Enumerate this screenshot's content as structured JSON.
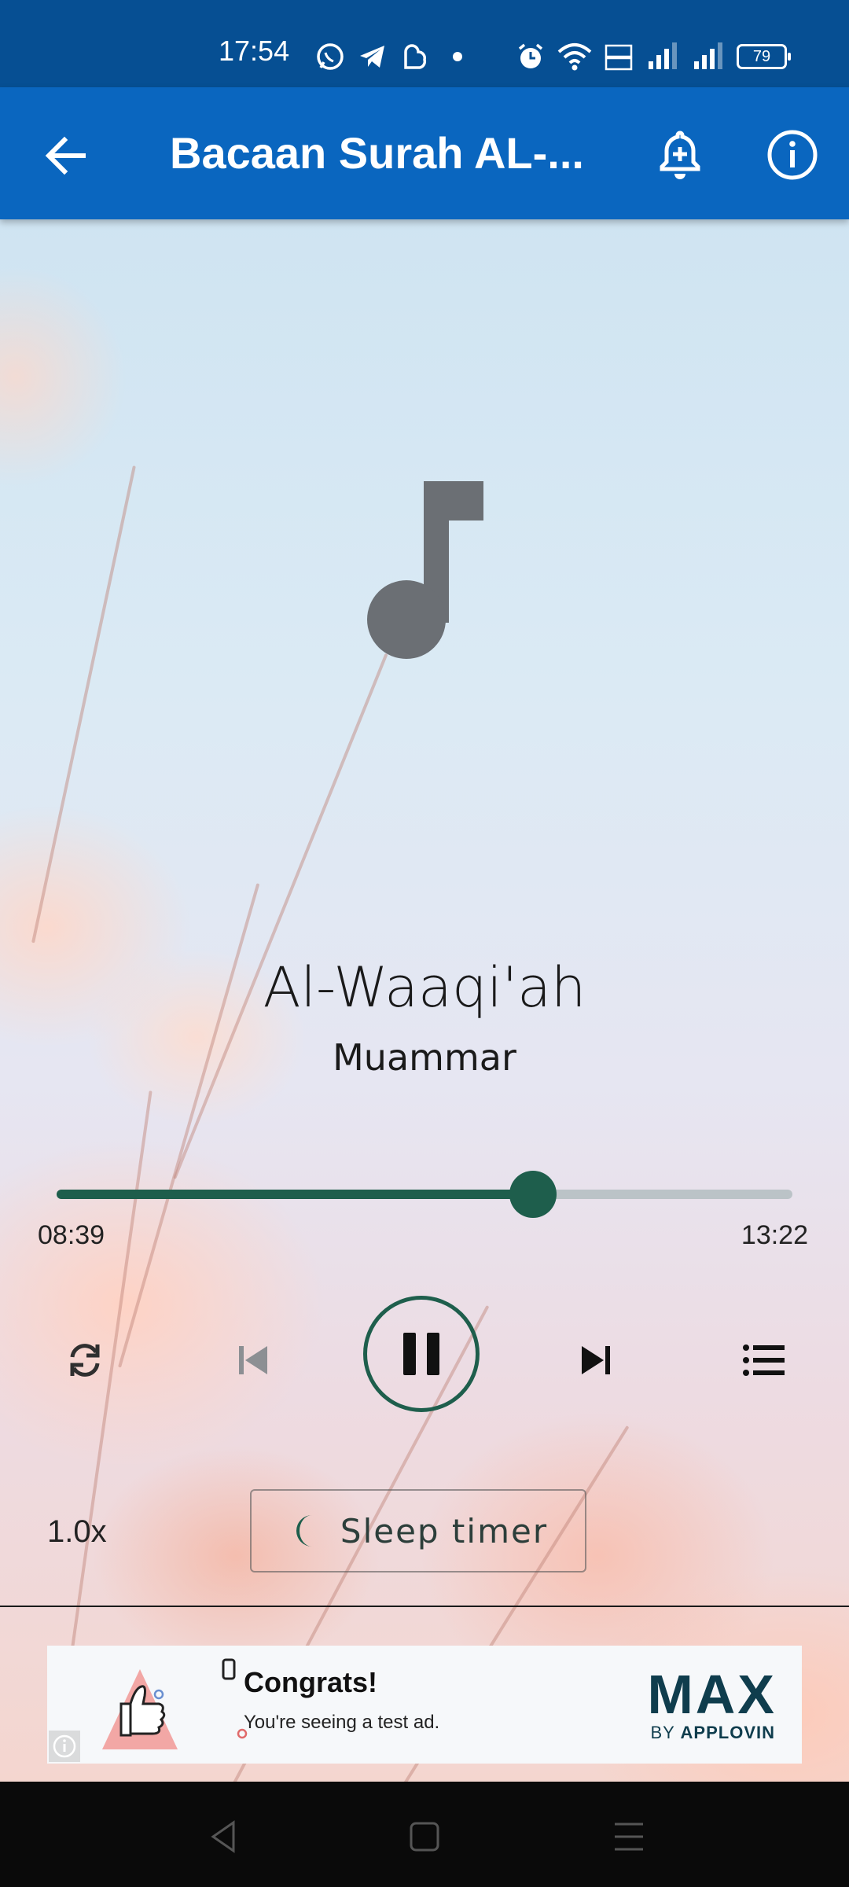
{
  "status_bar": {
    "time": "17:54",
    "battery": "79",
    "notification_icons": [
      "whatsapp-icon",
      "telegram-icon",
      "messenger-icon",
      "dot-icon"
    ],
    "system_icons": [
      "alarm-icon",
      "wifi-icon",
      "volte-icon",
      "signal-icon",
      "signal-icon"
    ]
  },
  "app_bar": {
    "title": "Bacaan Surah AL-...",
    "color": "#0a66bf"
  },
  "player": {
    "track_title": "Al-Waaqi'ah",
    "artist": "Muammar",
    "elapsed": "08:39",
    "duration": "13:22",
    "progress_fraction": 0.647,
    "accent_color": "#1e5e4c",
    "speed": "1.0x",
    "sleep_timer_label": "Sleep timer"
  },
  "ad": {
    "title": "Congrats!",
    "subtitle": "You're seeing a test ad.",
    "brand": "MAX",
    "by_prefix": "BY ",
    "by_brand": "APPLOVIN"
  }
}
